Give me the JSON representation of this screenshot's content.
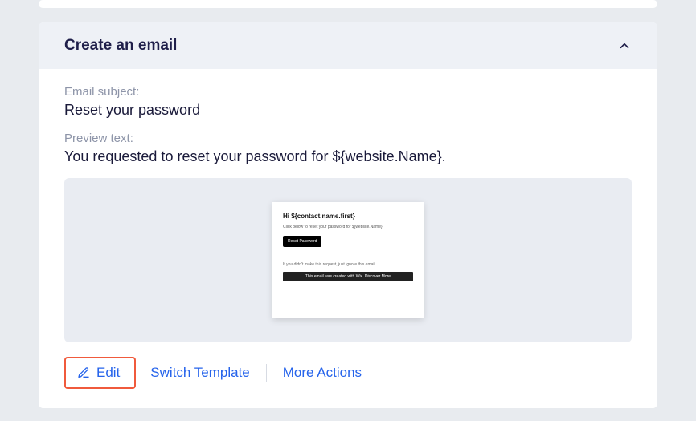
{
  "spacer": {},
  "accordion": {
    "title": "Create an email"
  },
  "email": {
    "subject_label": "Email subject:",
    "subject_value": "Reset your password",
    "preview_label": "Preview text:",
    "preview_value": "You requested to reset your password for ${website.Name}."
  },
  "mockup": {
    "greeting": "Hi ${contact.name.first}",
    "line": "Click below to reset your password for ${website.Name}.",
    "button": "Reset Password",
    "sub": "If you didn't make this request, just ignore this email.",
    "footer": "This email was created with Wix.  Discover More"
  },
  "actions": {
    "edit": "Edit",
    "switch": "Switch Template",
    "more": "More Actions"
  }
}
